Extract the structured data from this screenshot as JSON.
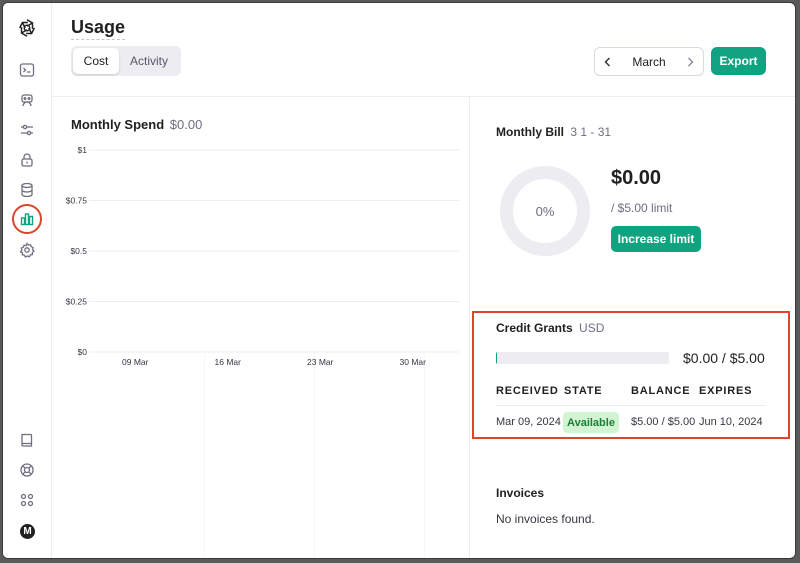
{
  "header": {
    "title": "Usage",
    "tabs": [
      {
        "label": "Cost",
        "selected": true
      },
      {
        "label": "Activity",
        "selected": false
      }
    ],
    "month": "March",
    "export_label": "Export"
  },
  "sidebar": {
    "icons": [
      "openai-logo-icon",
      "terminal-icon",
      "robot-icon",
      "sliders-icon",
      "lock-icon",
      "database-icon",
      "bar-chart-icon",
      "gear-icon",
      "book-icon",
      "help-icon",
      "apps-icon"
    ],
    "active": "bar-chart-icon",
    "avatar_initial": "M"
  },
  "spend": {
    "title": "Monthly Spend",
    "amount": "$0.00"
  },
  "chart_data": {
    "type": "bar",
    "categories": [
      "09 Mar",
      "16 Mar",
      "23 Mar",
      "30 Mar"
    ],
    "values": [
      0,
      0,
      0,
      0
    ],
    "yticks": [
      "$0",
      "$0.25",
      "$0.5",
      "$0.75",
      "$1"
    ],
    "ylim": [
      0,
      1
    ],
    "grid": true
  },
  "bill": {
    "title": "Monthly Bill",
    "range": "3 1 - 31",
    "percent_label": "0%",
    "amount": "$0.00",
    "limit": "/ $5.00 limit",
    "increase_label": "Increase limit"
  },
  "credit_grants": {
    "title": "Credit Grants",
    "currency": "USD",
    "used_fraction": 0,
    "amount": "$0.00 / $5.00",
    "headers": [
      "RECEIVED",
      "STATE",
      "BALANCE",
      "EXPIRES"
    ],
    "rows": [
      {
        "received": "Mar 09, 2024",
        "state": "Available",
        "balance": "$5.00 / $5.00",
        "expires": "Jun 10, 2024"
      }
    ]
  },
  "invoices": {
    "title": "Invoices",
    "empty": "No invoices found."
  },
  "colors": {
    "accent": "#10a37f",
    "highlight": "#e0442c",
    "badge_bg": "#d2f4d3"
  }
}
